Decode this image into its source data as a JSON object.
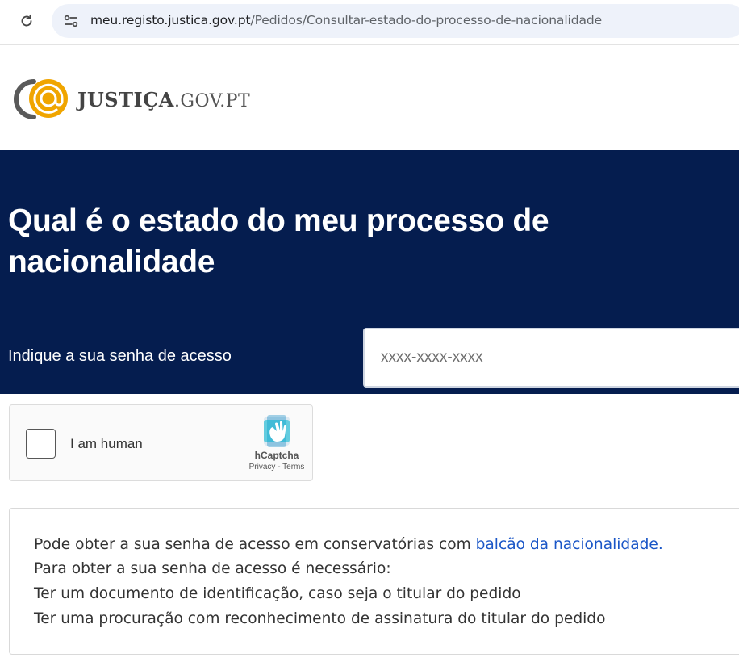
{
  "browser": {
    "url_host": "meu.registo.justica.gov.pt",
    "url_path": "/Pedidos/Consultar-estado-do-processo-de-nacionalidade"
  },
  "logo": {
    "name_bold": "JUSTIÇA",
    "name_light": ".GOV.PT"
  },
  "hero": {
    "title": "Qual é o estado do meu processo de nacionalidade",
    "code_label": "Indique a sua senha de acesso",
    "code_placeholder": "xxxx-xxxx-xxxx",
    "background_color": "#051d4f"
  },
  "captcha": {
    "label": "I am human",
    "brand": "hCaptcha",
    "links": "Privacy - Terms"
  },
  "info": {
    "line1_text": "Pode obter a sua senha de acesso em conservatórias com ",
    "line1_link": "balcão da nacionalidade.",
    "line2": "Para obter a sua senha de acesso é necessário:",
    "line3": "Ter um documento de identificação, caso seja o titular do pedido",
    "line4": "Ter uma procuração com reconhecimento de assinatura do titular do pedido",
    "link_color": "#1a56c7"
  },
  "icons": {
    "reload": "reload-icon",
    "site_info": "tune-icon",
    "logo": "justica-logo-mark",
    "hcaptcha": "hcaptcha-hand-logo"
  }
}
